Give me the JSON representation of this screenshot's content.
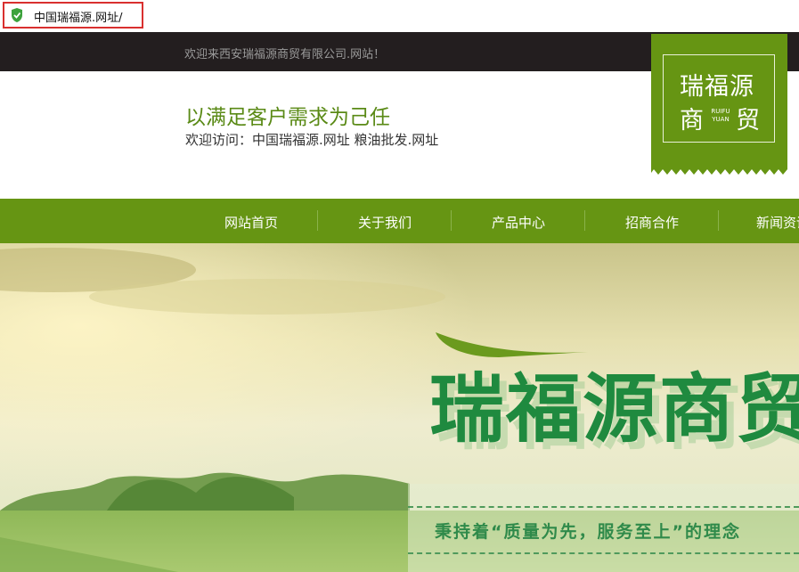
{
  "browser": {
    "url": "中国瑞福源.网址/"
  },
  "header": {
    "welcome": "欢迎来西安瑞福源商贸有限公司.网站！",
    "slogan": "以满足客户需求为己任",
    "visit": "欢迎访问：中国瑞福源.网址 粮油批发.网址"
  },
  "logo": {
    "line1": "瑞福源",
    "line2a": "商",
    "line2b": "贸",
    "en1": "RUIFU",
    "en2": "YUAN"
  },
  "nav": {
    "items": [
      {
        "label": "网站首页"
      },
      {
        "label": "关于我们"
      },
      {
        "label": "产品中心"
      },
      {
        "label": "招商合作"
      },
      {
        "label": "新闻资讯"
      }
    ]
  },
  "banner": {
    "brand": "瑞福源商贸",
    "tagline": "秉持着“质量为先，服务至上”的理念"
  },
  "colors": {
    "primary_green": "#669513",
    "top_bar": "#231e1f",
    "slogan_green": "#5a8a16"
  }
}
